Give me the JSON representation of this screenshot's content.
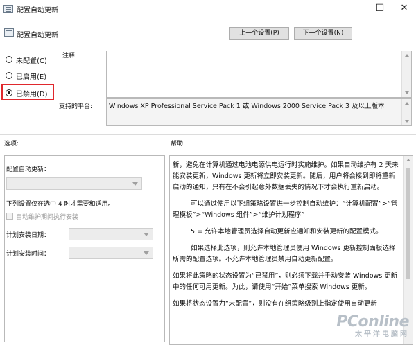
{
  "window": {
    "title": "配置自动更新",
    "minimize_glyph": "—",
    "maximize_glyph": "☐",
    "close_glyph": "✕"
  },
  "header": {
    "policy_name": "配置自动更新",
    "prev_button": "上一个设置(P)",
    "next_button": "下一个设置(N)"
  },
  "state_options": [
    {
      "label": "未配置(C)",
      "selected": false
    },
    {
      "label": "已启用(E)",
      "selected": false
    },
    {
      "label": "已禁用(D)",
      "selected": true
    }
  ],
  "comment": {
    "label": "注释:",
    "value": ""
  },
  "supported_on": {
    "label": "支持的平台:",
    "value": "Windows XP Professional Service Pack 1 或 Windows 2000 Service Pack 3 及以上版本"
  },
  "options": {
    "section_label": "选项:",
    "configure_label": "配置自动更新：",
    "configure_value": "",
    "note": "下列设置仅在选中 4 时才需要和适用。",
    "maintenance_checkbox": "自动维护期间执行安装",
    "install_day_label": "计划安装日期：",
    "install_day_value": "",
    "install_time_label": "计划安装时间：",
    "install_time_value": ""
  },
  "help": {
    "section_label": "帮助:",
    "paragraphs": [
      "新，避免在计算机通过电池电源供电运行时实施维护。如果自动维护有 2 天未能安装更新，Windows 更新将立即安装更新。随后，用户将会接到即将重新启动的通知，只有在不会引起意外数据丢失的情况下才会执行重新启动。",
      "可以通过使用以下组策略设置进一步控制自动维护：“计算机配置”>“管理模板”>“Windows 组件”>“维护计划程序”",
      "5 = 允许本地管理员选择自动更新应通知和安装更新的配置模式。",
      "如果选择此选项，则允许本地管理员使用 Windows 更新控制面板选择所需的配置选项。不允许本地管理员禁用自动更新配置。",
      "如果将此策略的状态设置为“已禁用”，则必须下载并手动安装 Windows 更新中的任何可用更新。为此，请使用“开始”菜单搜索 Windows 更新。",
      "如果将状态设置为“未配置”，则没有在组策略级别上指定使用自动更新"
    ]
  },
  "watermark": {
    "main": "PConline",
    "sub": "太平洋电脑网"
  }
}
